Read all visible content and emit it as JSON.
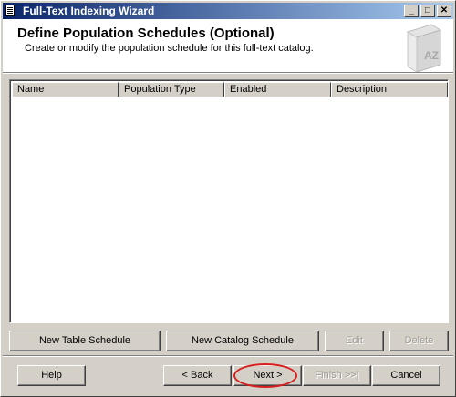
{
  "window": {
    "title": "Full-Text Indexing Wizard",
    "controls": {
      "minimize": "_",
      "maximize": "□",
      "close": "✕"
    }
  },
  "header": {
    "title": "Define Population Schedules (Optional)",
    "subtitle": "Create or modify the population schedule for this full-text catalog.",
    "icon": "book-az-icon",
    "icon_text": "AZ"
  },
  "list": {
    "columns": [
      "Name",
      "Population Type",
      "Enabled",
      "Description"
    ],
    "rows": []
  },
  "schedule_buttons": {
    "new_table": "New Table Schedule",
    "new_catalog": "New Catalog Schedule",
    "edit": "Edit",
    "delete": "Delete"
  },
  "footer_buttons": {
    "help": "Help",
    "back": "< Back",
    "next": "Next >",
    "finish": "Finish >>|",
    "cancel": "Cancel"
  },
  "annotation": {
    "color": "#d81e1e",
    "target": "next"
  }
}
